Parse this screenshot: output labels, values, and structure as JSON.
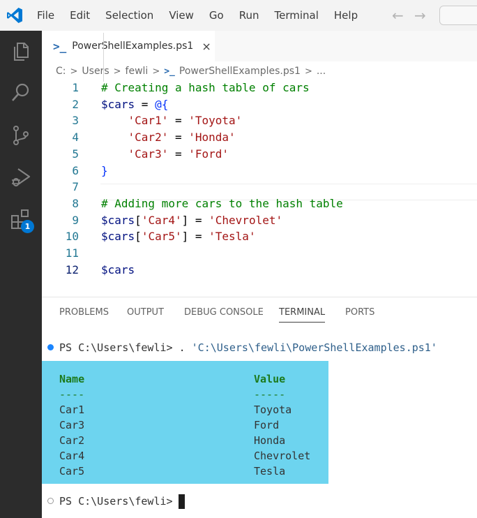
{
  "titlebar": {
    "logo_icon": "vscode-logo-icon",
    "menu": [
      "File",
      "Edit",
      "Selection",
      "View",
      "Go",
      "Run",
      "Terminal",
      "Help"
    ],
    "back_icon": "arrow-left-icon",
    "forward_icon": "arrow-right-icon"
  },
  "activity_bar": {
    "items": [
      {
        "name": "explorer",
        "icon": "files-icon"
      },
      {
        "name": "search",
        "icon": "search-icon"
      },
      {
        "name": "source-control",
        "icon": "source-control-icon"
      },
      {
        "name": "run-debug",
        "icon": "run-debug-icon"
      },
      {
        "name": "extensions",
        "icon": "extensions-icon",
        "badge": "1"
      }
    ],
    "badge_color": "#0078d4"
  },
  "tab": {
    "icon": "powershell-icon",
    "label": "PowerShellExamples.ps1",
    "close": "×"
  },
  "breadcrumb": {
    "items": [
      "C:",
      "Users",
      "fewli",
      "PowerShellExamples.ps1",
      "..."
    ]
  },
  "editor": {
    "lines": [
      {
        "num": "1",
        "tokens": [
          {
            "t": "# Creating a hash table of cars",
            "c": "comment"
          }
        ]
      },
      {
        "num": "2",
        "tokens": [
          {
            "t": "$cars",
            "c": "var"
          },
          {
            "t": " = ",
            "c": "op"
          },
          {
            "t": "@{",
            "c": "brace"
          }
        ]
      },
      {
        "num": "3",
        "tokens": [
          {
            "t": "    ",
            "c": "op"
          },
          {
            "t": "'Car1'",
            "c": "str"
          },
          {
            "t": " = ",
            "c": "op"
          },
          {
            "t": "'Toyota'",
            "c": "str"
          }
        ]
      },
      {
        "num": "4",
        "tokens": [
          {
            "t": "    ",
            "c": "op"
          },
          {
            "t": "'Car2'",
            "c": "str"
          },
          {
            "t": " = ",
            "c": "op"
          },
          {
            "t": "'Honda'",
            "c": "str"
          }
        ]
      },
      {
        "num": "5",
        "tokens": [
          {
            "t": "    ",
            "c": "op"
          },
          {
            "t": "'Car3'",
            "c": "str"
          },
          {
            "t": " = ",
            "c": "op"
          },
          {
            "t": "'Ford'",
            "c": "str"
          }
        ]
      },
      {
        "num": "6",
        "tokens": [
          {
            "t": "}",
            "c": "brace"
          }
        ]
      },
      {
        "num": "7",
        "tokens": []
      },
      {
        "num": "8",
        "tokens": [
          {
            "t": "# Adding more cars to the hash table",
            "c": "comment"
          }
        ]
      },
      {
        "num": "9",
        "tokens": [
          {
            "t": "$cars",
            "c": "var"
          },
          {
            "t": "[",
            "c": "op"
          },
          {
            "t": "'Car4'",
            "c": "str"
          },
          {
            "t": "] = ",
            "c": "op"
          },
          {
            "t": "'Chevrolet'",
            "c": "str"
          }
        ]
      },
      {
        "num": "10",
        "tokens": [
          {
            "t": "$cars",
            "c": "var"
          },
          {
            "t": "[",
            "c": "op"
          },
          {
            "t": "'Car5'",
            "c": "str"
          },
          {
            "t": "] = ",
            "c": "op"
          },
          {
            "t": "'Tesla'",
            "c": "str"
          }
        ]
      },
      {
        "num": "11",
        "tokens": []
      },
      {
        "num": "12",
        "tokens": [
          {
            "t": "$cars",
            "c": "var"
          }
        ]
      }
    ],
    "active_line": "12"
  },
  "panel": {
    "tabs": [
      "PROBLEMS",
      "OUTPUT",
      "DEBUG CONSOLE",
      "TERMINAL",
      "PORTS"
    ],
    "active_tab": "TERMINAL"
  },
  "terminal": {
    "command_prompt": "PS C:\\Users\\fewli> . ",
    "command_path": "'C:\\Users\\fewli\\PowerShellExamples.ps1'",
    "output": {
      "headers": [
        "Name",
        "Value"
      ],
      "separators": [
        "----",
        "-----"
      ],
      "rows": [
        [
          "Car1",
          "Toyota"
        ],
        [
          "Car3",
          "Ford"
        ],
        [
          "Car2",
          "Honda"
        ],
        [
          "Car4",
          "Chevrolet"
        ],
        [
          "Car5",
          "Tesla"
        ]
      ],
      "highlight_color": "#6dd4ef"
    },
    "final_prompt": "PS C:\\Users\\fewli>"
  }
}
